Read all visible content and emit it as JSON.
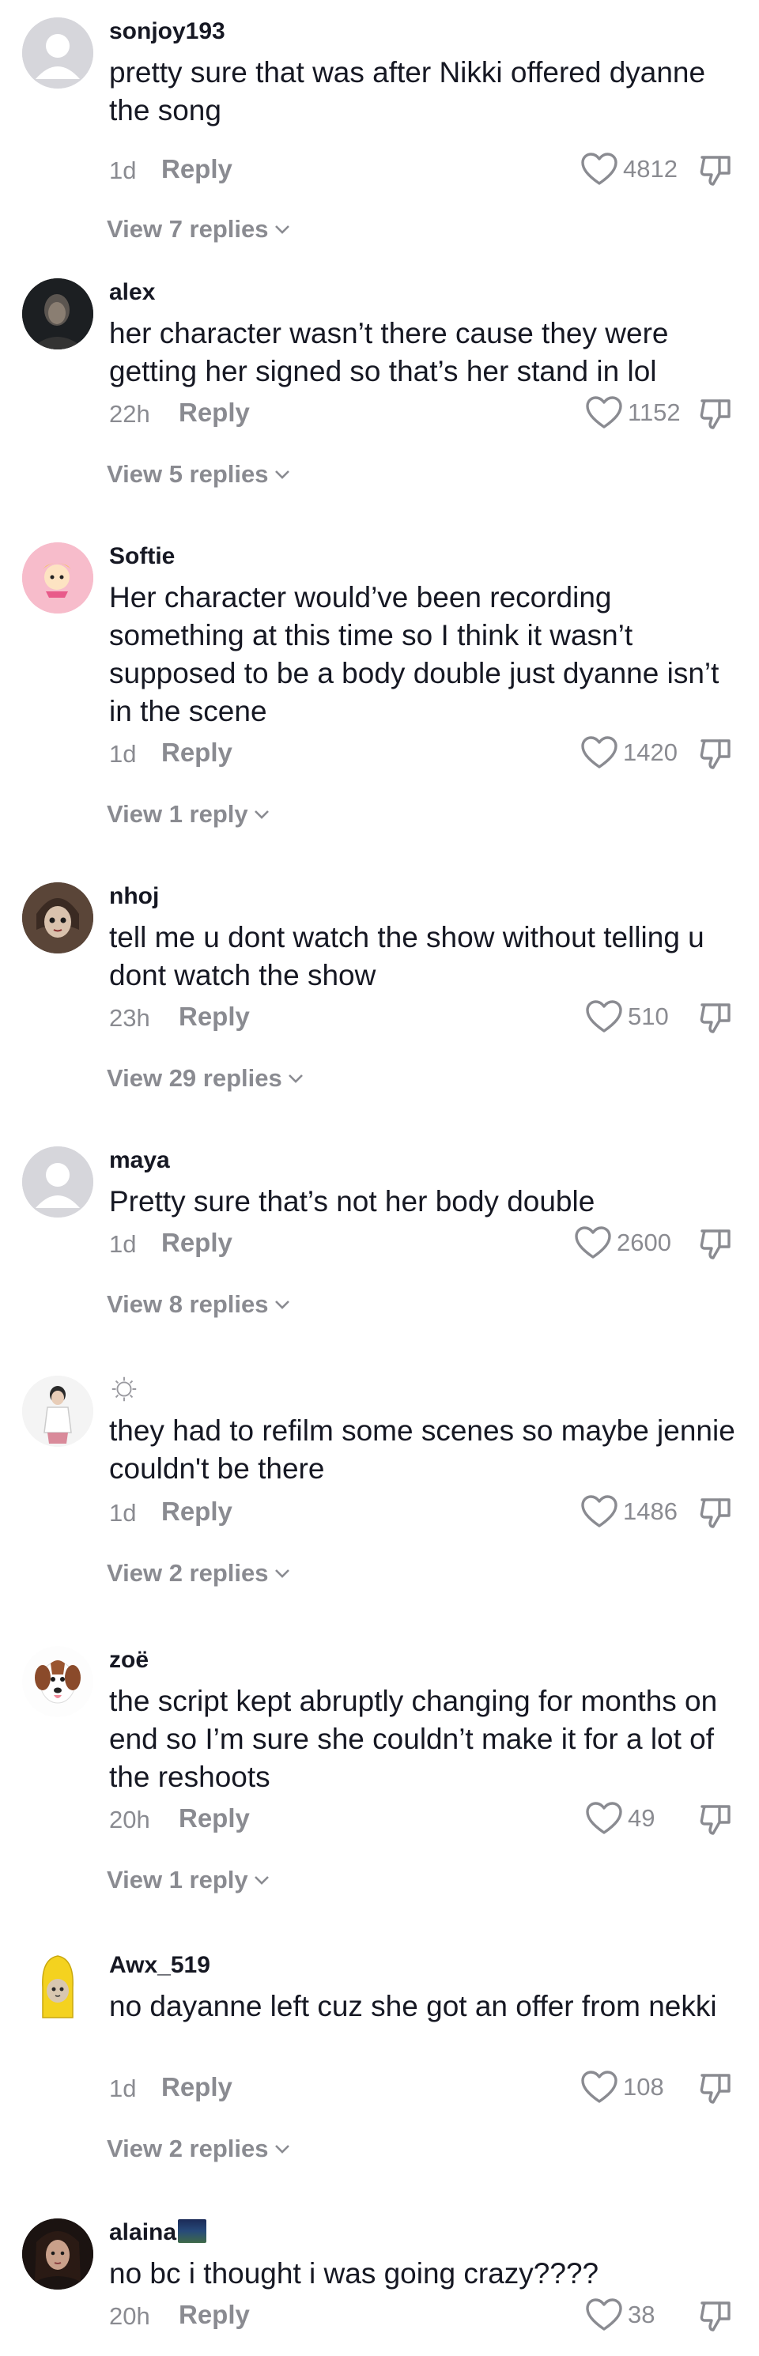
{
  "comments": [
    {
      "username": "sonjoy193",
      "text": "pretty sure that was after Nikki offered dyanne the song",
      "time": "1d",
      "reply_label": "Reply",
      "likes": "4812",
      "view_replies": "View 7 replies",
      "avatar": "default-avatar"
    },
    {
      "username": "alex",
      "text": "her character wasn’t there cause they were getting her signed so that’s her stand in lol",
      "time": "22h",
      "reply_label": "Reply",
      "likes": "1152",
      "view_replies": "View 5 replies",
      "avatar": "dark-photo-avatar"
    },
    {
      "username": "Softie",
      "text": "Her character would’ve been recording something at this time so I think it wasn’t supposed to be a body double just dyanne isn’t in the scene",
      "time": "1d",
      "reply_label": "Reply",
      "likes": "1420",
      "view_replies": "View 1 reply",
      "avatar": "pink-cartoon-avatar"
    },
    {
      "username": "nhoj",
      "text": "tell me u dont watch the show without telling u dont watch the show",
      "time": "23h",
      "reply_label": "Reply",
      "likes": "510",
      "view_replies": "View 29 replies",
      "avatar": "doll-avatar"
    },
    {
      "username": "maya",
      "text": "Pretty sure that’s not her body double",
      "time": "1d",
      "reply_label": "Reply",
      "likes": "2600",
      "view_replies": "View 8 replies",
      "avatar": "default-avatar"
    },
    {
      "username": "",
      "text": "they had to refilm some scenes so maybe jennie couldn't be there",
      "time": "1d",
      "reply_label": "Reply",
      "likes": "1486",
      "view_replies": "View 2 replies",
      "avatar": "person-avatar"
    },
    {
      "username": "zoë",
      "text": "the script kept abruptly changing for months on end so I’m sure she couldn’t make it for a lot of the reshoots",
      "time": "20h",
      "reply_label": "Reply",
      "likes": "49",
      "view_replies": "View 1 reply",
      "avatar": "dog-avatar"
    },
    {
      "username": "Awx_519",
      "text": "no dayanne left cuz she got an offer from nekki",
      "time": "1d",
      "reply_label": "Reply",
      "likes": "108",
      "view_replies": "View 2 replies",
      "avatar": "banana-cat-avatar"
    },
    {
      "username": "alaina",
      "text": "no bc i thought i was going crazy????",
      "time": "20h",
      "reply_label": "Reply",
      "likes": "38",
      "view_replies": "",
      "avatar": "dark-photo-avatar"
    }
  ],
  "colors": {
    "text": "#161823",
    "muted": "#8a8b91",
    "background": "#ffffff"
  }
}
